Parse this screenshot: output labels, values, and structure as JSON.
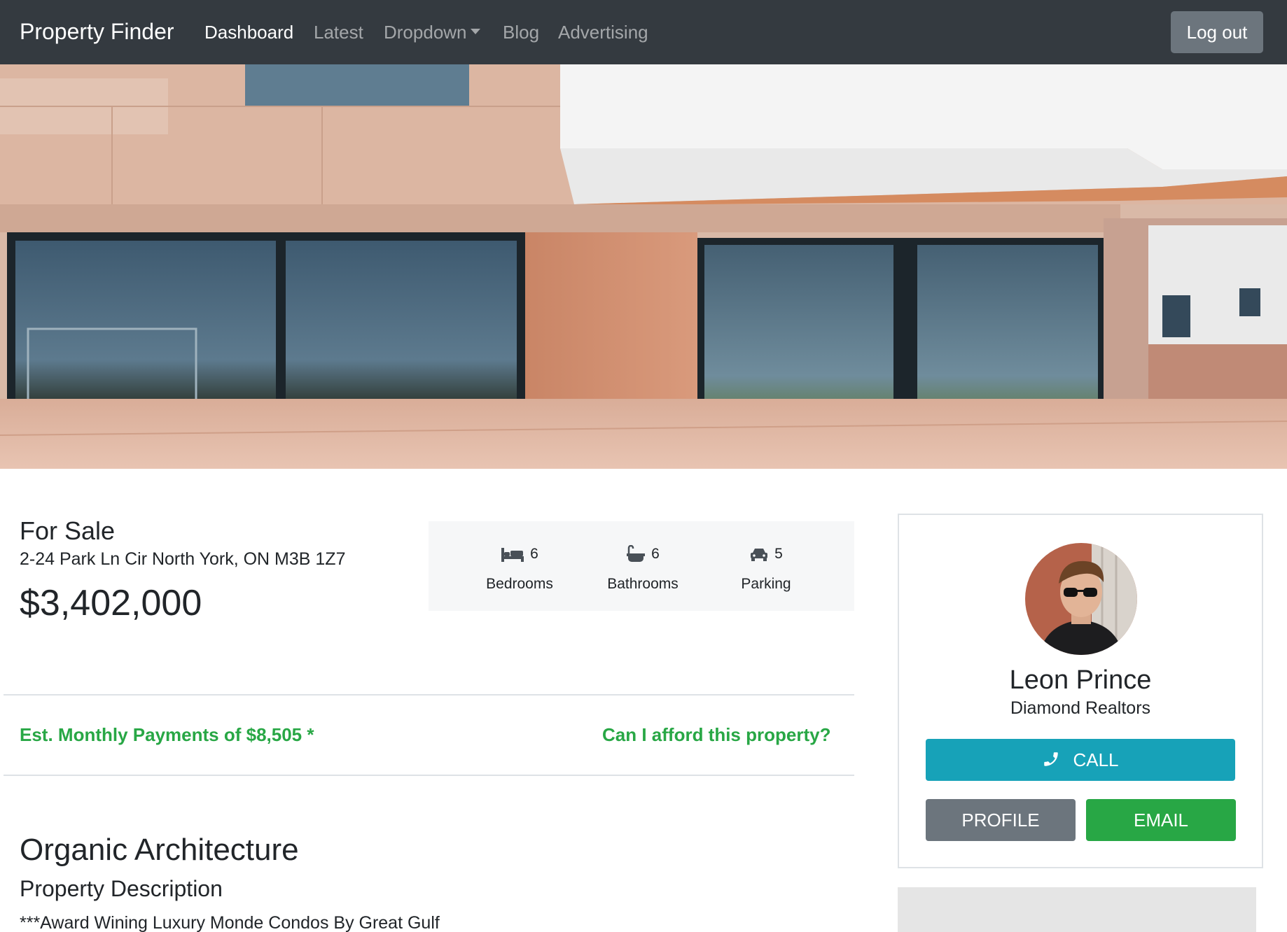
{
  "navbar": {
    "brand": "Property Finder",
    "links": [
      {
        "label": "Dashboard",
        "active": true
      },
      {
        "label": "Latest",
        "active": false
      },
      {
        "label": "Dropdown",
        "active": false
      },
      {
        "label": "Blog",
        "active": false
      },
      {
        "label": "Advertising",
        "active": false
      }
    ],
    "logout_label": "Log out"
  },
  "listing": {
    "status": "For Sale",
    "address": "2-24 Park Ln Cir North York, ON M3B 1Z7",
    "price": "$3,402,000",
    "features": [
      {
        "icon": "bed-icon",
        "count": "6",
        "label": "Bedrooms"
      },
      {
        "icon": "bath-icon",
        "count": "6",
        "label": "Bathrooms"
      },
      {
        "icon": "car-icon",
        "count": "5",
        "label": "Parking"
      }
    ],
    "monthly_payment": "Est. Monthly Payments of $8,505 *",
    "afford_link": "Can I afford this property?",
    "title": "Organic Architecture",
    "description_heading": "Property Description",
    "description": "***Award Wining Luxury Monde Condos By Great Gulf"
  },
  "agent": {
    "name": "Leon Prince",
    "company": "Diamond Realtors",
    "call_label": "CALL",
    "profile_label": "PROFILE",
    "email_label": "EMAIL"
  },
  "colors": {
    "navbar": "#343a40",
    "call": "#17a2b8",
    "profile": "#6c757d",
    "email": "#28a745",
    "link_green": "#28a745"
  }
}
